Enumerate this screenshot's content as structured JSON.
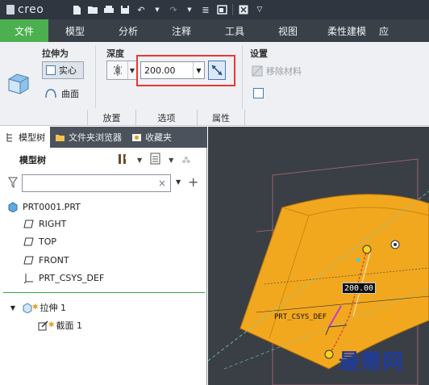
{
  "app": {
    "logo_text": "creo"
  },
  "quick_access": [
    "new-icon",
    "open-icon",
    "save-icon",
    "undo-icon",
    "redo-icon",
    "regenerate-icon",
    "windows-icon",
    "close-icon"
  ],
  "ribbon_tabs": [
    "文件",
    "模型",
    "分析",
    "注释",
    "工具",
    "视图",
    "柔性建模",
    "应"
  ],
  "ribbon": {
    "extrude_as_label": "拉伸为",
    "solid_label": "实心",
    "surface_label": "曲面",
    "depth_label": "深度",
    "depth_value": "200.00",
    "settings_label": "设置",
    "remove_material_label": "移除材料",
    "footer": [
      "放置",
      "选项",
      "属性"
    ]
  },
  "panel": {
    "tabs": [
      "模型树",
      "文件夹浏览器",
      "收藏夹"
    ],
    "tree_title": "模型树",
    "filter_placeholder": "",
    "items": [
      "PRT0001.PRT",
      "RIGHT",
      "TOP",
      "FRONT",
      "PRT_CSYS_DEF",
      "拉伸 1",
      "截面 1"
    ]
  },
  "viewport": {
    "dimension_label": "200.00",
    "csys_label": "PRT_CSYS_DEF",
    "watermark": "最需网",
    "colors": {
      "body": "#f2a81e",
      "background": "#3a3f45",
      "datum": "#e07070"
    }
  }
}
